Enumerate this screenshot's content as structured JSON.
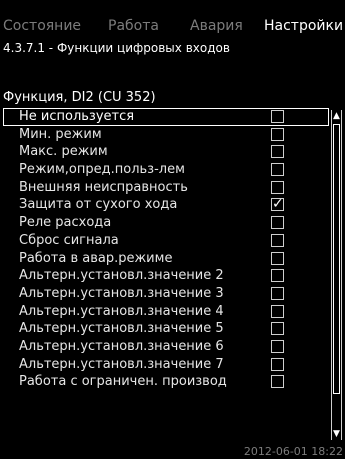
{
  "tabs": [
    {
      "label": "Состояние",
      "active": false
    },
    {
      "label": "Работа",
      "active": false
    },
    {
      "label": "Авария",
      "active": false
    },
    {
      "label": "Настройки",
      "active": true
    }
  ],
  "screen_title": "4.3.7.1 - Функции цифровых входов",
  "section_title": "Функция, DI2 (CU 352)",
  "options": [
    {
      "label": "Не используется",
      "checked": false,
      "selected": true
    },
    {
      "label": "Мин. режим",
      "checked": false
    },
    {
      "label": "Макс. режим",
      "checked": false
    },
    {
      "label": "Режим,опред.польз-лем",
      "checked": false
    },
    {
      "label": "Внешняя неисправность",
      "checked": false
    },
    {
      "label": "Защита от сухого хода",
      "checked": true
    },
    {
      "label": "Реле расхода",
      "checked": false
    },
    {
      "label": "Сброс сигнала",
      "checked": false
    },
    {
      "label": "Работа в авар.режиме",
      "checked": false
    },
    {
      "label": "Альтерн.установл.значение 2",
      "checked": false
    },
    {
      "label": "Альтерн.установл.значение 3",
      "checked": false
    },
    {
      "label": "Альтерн.установл.значение 4",
      "checked": false
    },
    {
      "label": "Альтерн.установл.значение 5",
      "checked": false
    },
    {
      "label": "Альтерн.установл.значение 6",
      "checked": false
    },
    {
      "label": "Альтерн.установл.значение 7",
      "checked": false
    },
    {
      "label": "Работа с ограничен. производ",
      "checked": false
    }
  ],
  "check_mark": "✓",
  "scroll_up_icon": "▲",
  "scroll_down_icon": "▼",
  "footer_timestamp": "2012-06-01 18:22"
}
